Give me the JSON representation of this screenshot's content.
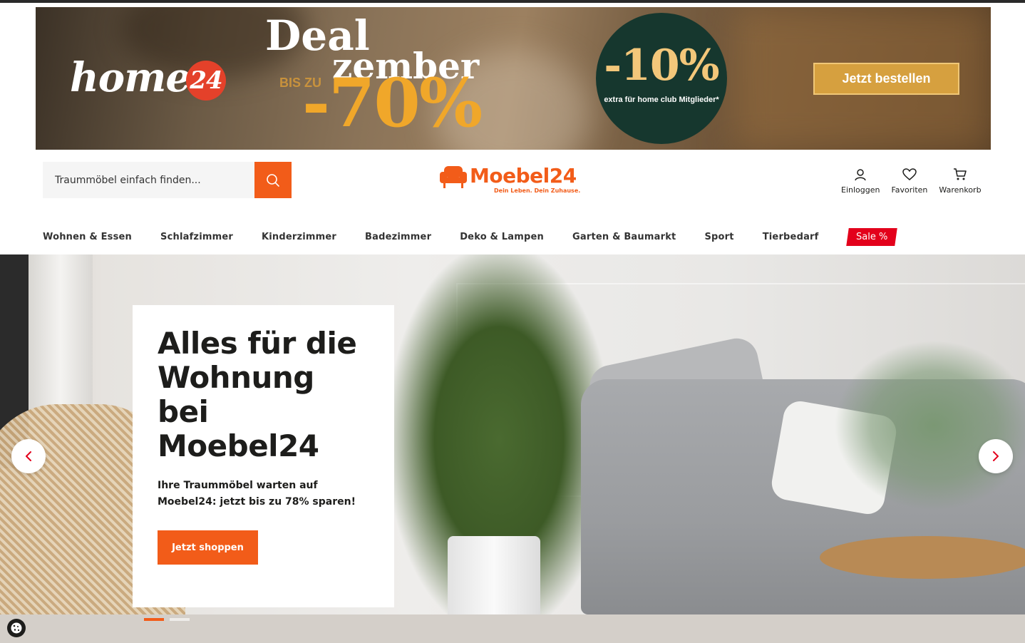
{
  "promo": {
    "brand_logo": "home",
    "brand_logo_number": "24",
    "deal_title_line1": "Deal",
    "deal_title_line2": "zember",
    "discount_prefix": "BIS ZU",
    "discount_value": "-70%",
    "club_discount": "-10%",
    "club_text": "extra für home club Mitglieder*",
    "cta_label": "Jetzt bestellen"
  },
  "header": {
    "search_placeholder": "Traummöbel einfach finden...",
    "logo_text": "Moebel24",
    "logo_claim": "Dein Leben. Dein Zuhause.",
    "actions": [
      {
        "label": "Einloggen",
        "icon": "user-icon"
      },
      {
        "label": "Favoriten",
        "icon": "heart-icon"
      },
      {
        "label": "Warenkorb",
        "icon": "cart-icon"
      }
    ]
  },
  "nav": {
    "items": [
      "Wohnen & Essen",
      "Schlafzimmer",
      "Kinderzimmer",
      "Badezimmer",
      "Deko & Lampen",
      "Garten & Baumarkt",
      "Sport",
      "Tierbedarf"
    ],
    "sale_label": "Sale %"
  },
  "hero": {
    "title": "Alles für die Wohnung bei Moebel24",
    "subtitle": "Ihre Traummöbel warten auf Moebel24: jetzt bis zu 78% sparen!",
    "cta_label": "Jetzt shoppen",
    "slides_total": 2,
    "active_slide": 1
  },
  "colors": {
    "brand_orange": "#f25c19",
    "sale_red": "#e3001b",
    "club_green": "#16372e",
    "promo_gold": "#d6a03f"
  }
}
